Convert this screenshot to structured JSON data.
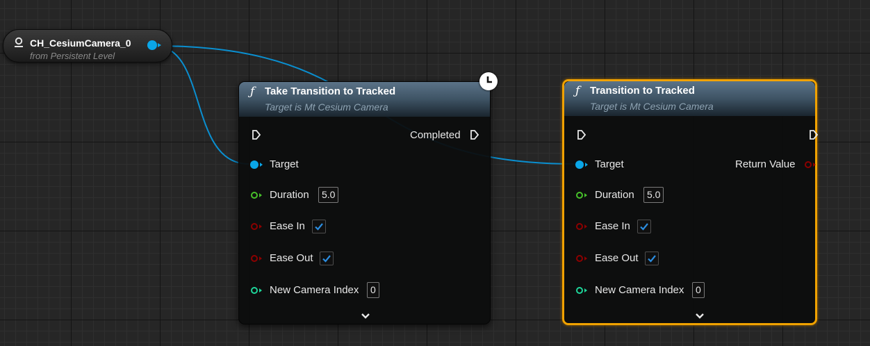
{
  "actor_node": {
    "title": "CH_CesiumCamera_0",
    "subtitle": "from Persistent Level",
    "icon": "actor-reference-icon"
  },
  "nodes": [
    {
      "id": "take-transition",
      "glyph": "ƒ",
      "title": "Take Transition to Tracked",
      "subtitle": "Target is Mt Cesium Camera",
      "latent_icon": "clock-icon",
      "exec_out_label": "Completed",
      "target_label": "Target",
      "return_label": "",
      "duration_label": "Duration",
      "duration_value": "5.0",
      "ease_in_label": "Ease In",
      "ease_in_checked": true,
      "ease_out_label": "Ease Out",
      "ease_out_checked": true,
      "camera_index_label": "New Camera Index",
      "camera_index_value": "0",
      "selected": false
    },
    {
      "id": "transition",
      "glyph": "ƒ",
      "title": "Transition to Tracked",
      "subtitle": "Target is Mt Cesium Camera",
      "exec_out_label": "",
      "target_label": "Target",
      "return_label": "Return Value",
      "duration_label": "Duration",
      "duration_value": "5.0",
      "ease_in_label": "Ease In",
      "ease_in_checked": true,
      "ease_out_label": "Ease Out",
      "ease_out_checked": true,
      "camera_index_label": "New Camera Index",
      "camera_index_value": "0",
      "selected": true
    }
  ],
  "colors": {
    "object_pin": "#0aa6e8",
    "float_pin": "#47c12a",
    "bool_pin": "#8c0000",
    "int_pin": "#1ed69a",
    "selection": "#f1a200",
    "wire": "#0a8fd0"
  }
}
